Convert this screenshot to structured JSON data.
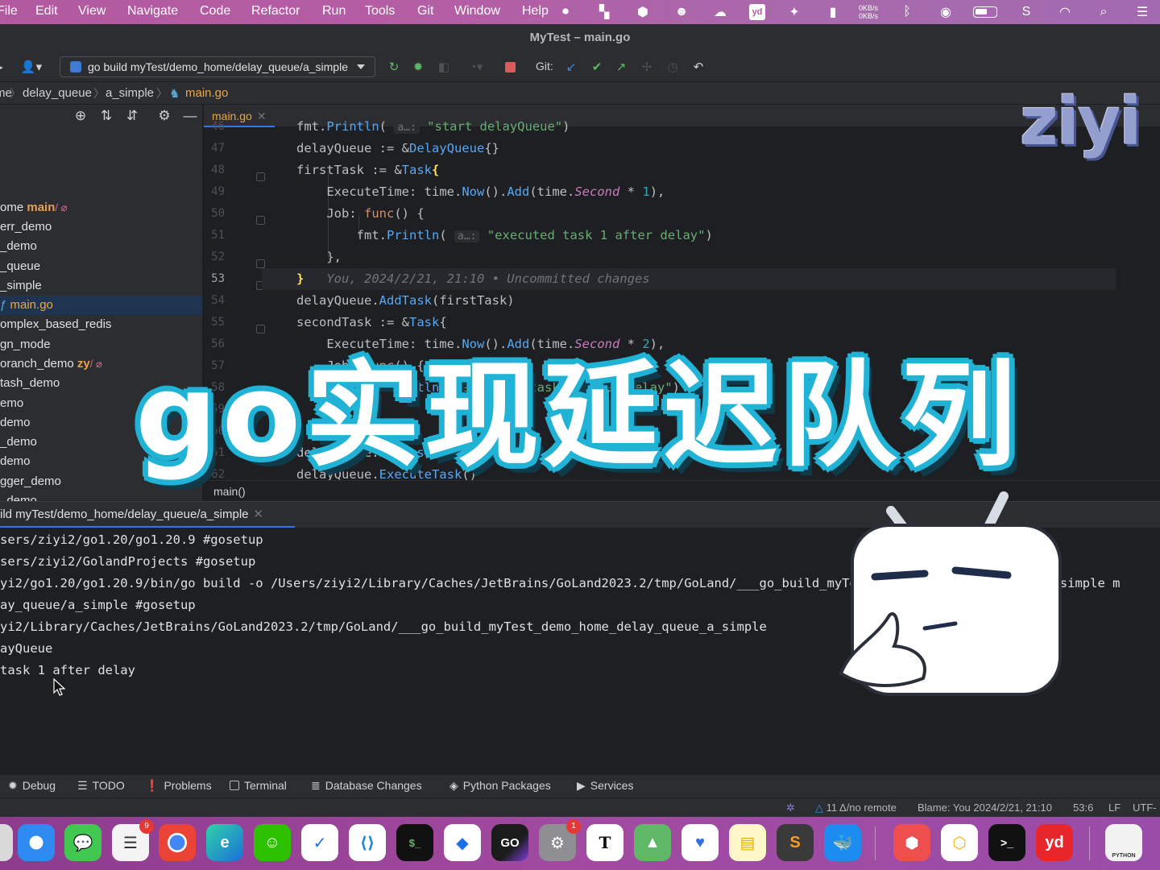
{
  "menubar": {
    "items": [
      "File",
      "Edit",
      "View",
      "Navigate",
      "Code",
      "Refactor",
      "Run",
      "Tools",
      "Git",
      "Window",
      "Help"
    ],
    "tray_icons": [
      "stop-circle-icon",
      "bookmark-app-icon",
      "shield-icon",
      "face-icon",
      "cloud-icon",
      "youdao-icon",
      "fish-icon",
      "trash-icon"
    ],
    "netspeed_up": "0KB/s",
    "netspeed_down": "0KB/s",
    "youdao_label": "yd"
  },
  "window": {
    "title": "MyTest – main.go"
  },
  "toolbar": {
    "run_config": "go build myTest/demo_home/delay_queue/a_simple",
    "git_label": "Git:"
  },
  "breadcrumbs": [
    "me",
    "delay_queue",
    "a_simple",
    "main.go"
  ],
  "project": {
    "rows": [
      {
        "label": "ome",
        "branch": "main",
        "mark": "/ ⌀"
      },
      {
        "label": "err_demo"
      },
      {
        "label": "_demo"
      },
      {
        "label": "_queue"
      },
      {
        "label": "_simple"
      },
      {
        "label": "main.go",
        "selected": true
      },
      {
        "label": "omplex_based_redis"
      },
      {
        "label": "gn_mode"
      },
      {
        "label": "oranch_demo",
        "branch": "zy",
        "mark": "/ ⌀"
      },
      {
        "label": "tash_demo"
      },
      {
        "label": "emo"
      },
      {
        "label": "demo"
      },
      {
        "label": "_demo"
      },
      {
        "label": "demo"
      },
      {
        "label": "gger_demo"
      },
      {
        "label": "_demo"
      }
    ]
  },
  "editor": {
    "tab_label": "main.go",
    "line_numbers": [
      "46",
      "47",
      "48",
      "49",
      "50",
      "51",
      "52",
      "53",
      "54",
      "55",
      "56",
      "57",
      "58",
      "59",
      "60",
      "61",
      "62"
    ],
    "current_line": "53",
    "footer": "main()",
    "blame": "You, 2024/2/21, 21:10 • Uncommitted changes",
    "hint": "a…:"
  },
  "run": {
    "tab_label": "ild myTest/demo_home/delay_queue/a_simple",
    "output": [
      "sers/ziyi2/go1.20/go1.20.9 #gosetup",
      "sers/ziyi2/GolandProjects #gosetup",
      "yi2/go1.20/go1.20.9/bin/go build -o /Users/ziyi2/Library/Caches/JetBrains/GoLand2023.2/tmp/GoLand/___go_build_myTest_demo_home_delay_queue_a_simple m",
      "ay_queue/a_simple #gosetup",
      "yi2/Library/Caches/JetBrains/GoLand2023.2/tmp/GoLand/___go_build_myTest_demo_home_delay_queue_a_simple",
      "ayQueue",
      "task 1 after delay"
    ]
  },
  "toolwindows": [
    "Debug",
    "TODO",
    "Problems",
    "Terminal",
    "Database Changes",
    "Python Packages",
    "Services"
  ],
  "status": {
    "git": "11 Δ/no remote",
    "blame": "Blame: You 2024/2/21, 21:10",
    "position": "53:6",
    "line_sep": "LF",
    "encoding": "UTF-"
  },
  "dock": {
    "reminders_badge": "9",
    "settings_badge": "1",
    "goland_label": "GO",
    "typora_label": "T",
    "youdao_label": "yd",
    "python_label": "PYTHON"
  },
  "overlay": {
    "watermark": "ziyi",
    "title": "go实现延迟队列"
  },
  "colors": {
    "accent": "#3574f0",
    "menubar": "#b25aa0",
    "title_outline": "#21b3d6"
  }
}
